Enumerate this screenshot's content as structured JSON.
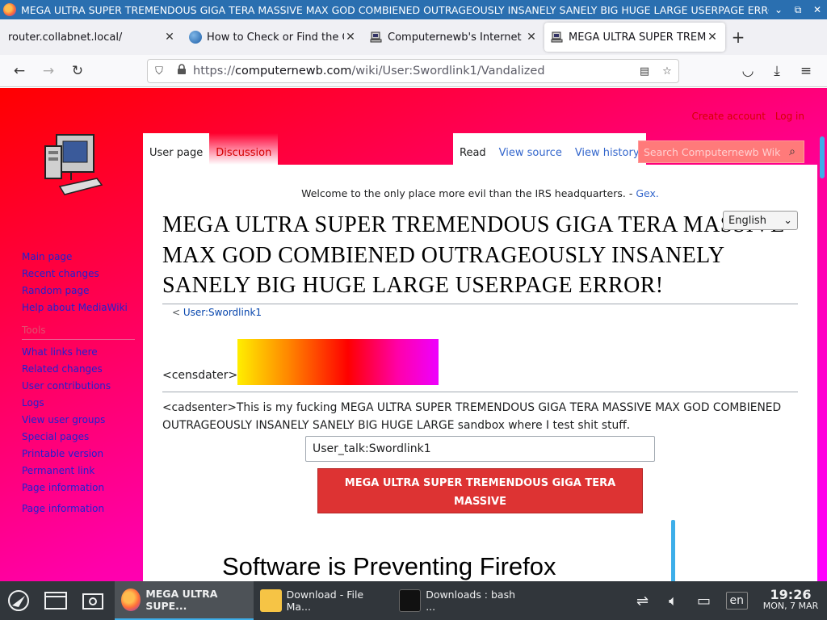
{
  "window": {
    "title": "MEGA ULTRA SUPER TREMENDOUS GIGA TERA MASSIVE MAX GOD COMBIENED OUTRAGEOUSLY INSANELY SANELY BIG HUGE LARGE USERPAGE ERROR! - Comp...",
    "minimize": "⌄",
    "maximize": "⧉",
    "close": "✕"
  },
  "tabs": [
    {
      "label": "router.collabnet.local/",
      "close": "✕",
      "icon": "none"
    },
    {
      "label": "How to Check or Find the Op",
      "close": "✕",
      "icon": "globe-icon"
    },
    {
      "label": "Computernewb's Internet P",
      "close": "✕",
      "icon": "computernewb-icon"
    },
    {
      "label": "MEGA ULTRA SUPER TREME",
      "close": "✕",
      "icon": "computernewb-icon"
    }
  ],
  "newtab": "+",
  "nav": {
    "back": "←",
    "forward": "→",
    "reload": "↻",
    "url_prefix": "https://",
    "url_host": "computernewb.com",
    "url_path": "/wiki/User:Swordlink1/Vandalized",
    "shield": "⛉",
    "lock": "🔒",
    "reader": "▤",
    "star": "☆",
    "pocket": "◡",
    "download": "⤓",
    "menu": "≡"
  },
  "wiki": {
    "personal": {
      "create": "Create account",
      "login": "Log in"
    },
    "tabs_left": [
      {
        "label": "User page"
      },
      {
        "label": "Discussion"
      }
    ],
    "tabs_right": [
      {
        "label": "Read"
      },
      {
        "label": "View source"
      },
      {
        "label": "View history"
      }
    ],
    "search_placeholder": "Search Computernewb Wiki",
    "search_icon": "⌕",
    "sidebar": {
      "nav": [
        "Main page",
        "Recent changes",
        "Random page",
        "Help about MediaWiki"
      ],
      "tools_heading": "Tools",
      "tools": [
        "What links here",
        "Related changes",
        "User contributions",
        "Logs",
        "View user groups",
        "Special pages",
        "Printable version",
        "Permanent link",
        "Page information"
      ],
      "extra": "Page information"
    },
    "sitenotice": "Welcome to the only place more evil than the IRS headquarters. - ",
    "sitenotice_link": "Gex.",
    "language": "English",
    "language_arrow": "⌄",
    "title": "MEGA ULTRA SUPER TREMENDOUS GIGA TERA MASSIVE MAX GOD COMBIENED OUTRAGEOUSLY INSANELY SANELY BIG HUGE LARGE USERPAGE ERROR!",
    "subpage_prefix": "< ",
    "subpage_link": "User:Swordlink1",
    "censor_label": "<censdater>",
    "paragraph": "<cadsenter>This is my fucking MEGA ULTRA SUPER TREMENDOUS GIGA TERA MASSIVE MAX GOD COMBIENED OUTRAGEOUSLY INSANELY SANELY BIG HUGE LARGE sandbox where I test shit stuff.",
    "input_value": "User_talk:Swordlink1",
    "button_line1": "MEGA ULTRA SUPER TREMENDOUS GIGA TERA MASSIVE",
    "button_line2": "MEGA ULTRA SUPER TREMENDOUS GIGA TERA MASSIVE",
    "big_heading": "Software is Preventing Firefox"
  },
  "taskbar": {
    "tasks": [
      {
        "label": "MEGA ULTRA SUPE...",
        "icon": "firefox-icon"
      },
      {
        "label": "Download - File Ma...",
        "icon": "folder-download-icon"
      },
      {
        "label": "Downloads : bash ...",
        "icon": "terminal-icon"
      }
    ],
    "lang": "en",
    "time": "19:26",
    "date": "MON, 7 MAR"
  }
}
